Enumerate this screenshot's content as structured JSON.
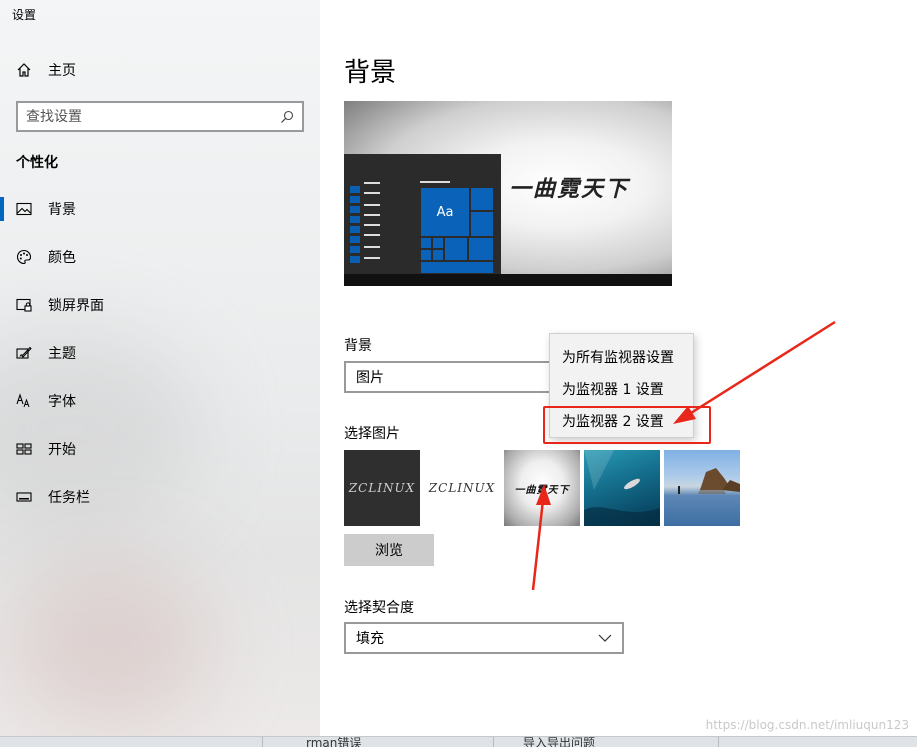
{
  "app": {
    "title": "设置"
  },
  "sidebar": {
    "home_label": "主页",
    "search_placeholder": "查找设置",
    "section_title": "个性化",
    "items": [
      {
        "label": "背景",
        "icon": "picture-icon",
        "active": true
      },
      {
        "label": "颜色",
        "icon": "palette-icon"
      },
      {
        "label": "锁屏界面",
        "icon": "lock-screen-icon"
      },
      {
        "label": "主题",
        "icon": "theme-icon"
      },
      {
        "label": "字体",
        "icon": "font-icon"
      },
      {
        "label": "开始",
        "icon": "start-icon"
      },
      {
        "label": "任务栏",
        "icon": "taskbar-icon"
      }
    ]
  },
  "main": {
    "title": "背景",
    "preview": {
      "tile_text": "Aa",
      "wallpaper_text": "一曲霓天下"
    },
    "background_label": "背景",
    "background_value": "图片",
    "choose_picture_label": "选择图片",
    "thumbnails": [
      {
        "name": "ZCLINUX",
        "text": "ZCLINUX"
      },
      {
        "name": "ZCLINUX-light",
        "text": "ZCLINUX"
      },
      {
        "name": "calligraphy",
        "text": "一曲霓天下"
      },
      {
        "name": "underwater",
        "text": ""
      },
      {
        "name": "coast",
        "text": ""
      }
    ],
    "browse_label": "浏览",
    "fit_label": "选择契合度",
    "fit_value": "填充"
  },
  "context_menu": {
    "items": [
      "为所有监视器设置",
      "为监视器 1 设置",
      "为监视器 2 设置"
    ]
  },
  "taskbar": {
    "items": [
      "rman错误",
      "导入导出问题"
    ]
  },
  "watermark": "https://blog.csdn.net/imliuqun123",
  "colors": {
    "accent": "#0067c0",
    "annotation": "#e8271a"
  }
}
